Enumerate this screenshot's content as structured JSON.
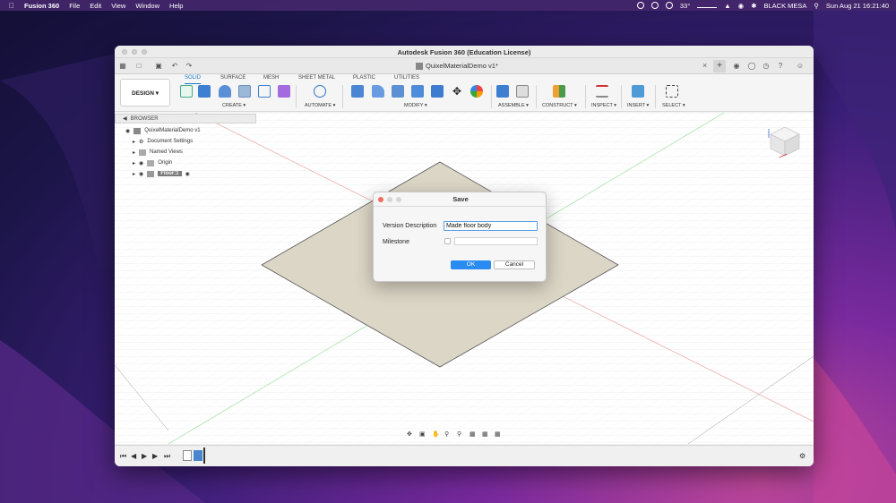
{
  "menubar": {
    "app_name": "Fusion 360",
    "menus": [
      "File",
      "Edit",
      "View",
      "Window",
      "Help"
    ],
    "temperature": "33°",
    "network_name": "BLACK MESA",
    "datetime": "Sun Aug 21  16:21:40"
  },
  "window": {
    "title": "Autodesk Fusion 360 (Education License)",
    "doc_tab": "QuixelMaterialDemo v1*"
  },
  "toolbar": {
    "workspace": "DESIGN ▾",
    "tabs": [
      "SOLID",
      "SURFACE",
      "MESH",
      "SHEET METAL",
      "PLASTIC",
      "UTILITIES"
    ],
    "groups": [
      "CREATE ▾",
      "AUTOMATE ▾",
      "MODIFY ▾",
      "ASSEMBLE ▾",
      "CONSTRUCT ▾",
      "INSPECT ▾",
      "INSERT ▾",
      "SELECT ▾"
    ]
  },
  "browser": {
    "header": "BROWSER",
    "root": "QuixelMaterialDemo v1",
    "items": [
      "Document Settings",
      "Named Views",
      "Origin",
      "Floor:1"
    ]
  },
  "dialog": {
    "title": "Save",
    "version_label": "Version Description",
    "version_value": "Made floor body",
    "milestone_label": "Milestone",
    "ok_label": "OK",
    "cancel_label": "Cancel"
  },
  "colors": {
    "accent": "#2a8bf2",
    "floor_fill": "#dcd6c6",
    "x_axis": "#e05050",
    "y_axis": "#4cc24c"
  }
}
